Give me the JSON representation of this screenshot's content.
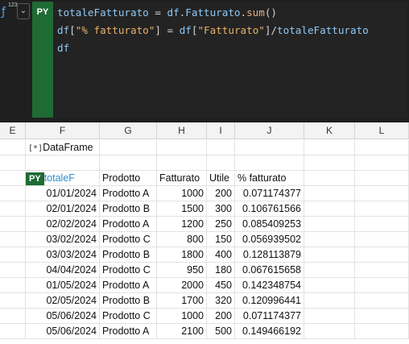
{
  "toolbar": {
    "fx_icon": "function-icon",
    "fx_sub": "123",
    "chevron": "⌄"
  },
  "editor": {
    "badge": "PY",
    "lines": [
      [
        {
          "t": "totaleFatturato",
          "c": "var"
        },
        {
          "t": " = ",
          "c": "op"
        },
        {
          "t": "df",
          "c": "var"
        },
        {
          "t": ".",
          "c": "op"
        },
        {
          "t": "Fatturato",
          "c": "var"
        },
        {
          "t": ".",
          "c": "op"
        },
        {
          "t": "sum",
          "c": "fn"
        },
        {
          "t": "()",
          "c": "op"
        }
      ],
      [
        {
          "t": "df",
          "c": "var"
        },
        {
          "t": "[",
          "c": "op"
        },
        {
          "t": "\"% fatturato\"",
          "c": "str"
        },
        {
          "t": "] = ",
          "c": "op"
        },
        {
          "t": "df",
          "c": "var"
        },
        {
          "t": "[",
          "c": "op"
        },
        {
          "t": "\"Fatturato\"",
          "c": "str"
        },
        {
          "t": "]/",
          "c": "op"
        },
        {
          "t": "totaleFatturato",
          "c": "var"
        }
      ],
      [
        {
          "t": "df",
          "c": "var"
        }
      ]
    ]
  },
  "columns": [
    "E",
    "F",
    "G",
    "H",
    "I",
    "J",
    "K",
    "L"
  ],
  "dataframe_label": "DataFrame",
  "dataframe_icon": "[*]",
  "table": {
    "py_badge": "PY",
    "index_header": "totaleF",
    "headers": [
      "Prodotto",
      "Fatturato",
      "Utile",
      "% fatturato"
    ],
    "rows": [
      [
        "01/01/2024",
        "Prodotto A",
        "1000",
        "200",
        "0.071174377"
      ],
      [
        "02/01/2024",
        "Prodotto B",
        "1500",
        "300",
        "0.106761566"
      ],
      [
        "02/02/2024",
        "Prodotto A",
        "1200",
        "250",
        "0.085409253"
      ],
      [
        "03/02/2024",
        "Prodotto C",
        "800",
        "150",
        "0.056939502"
      ],
      [
        "03/03/2024",
        "Prodotto B",
        "1800",
        "400",
        "0.128113879"
      ],
      [
        "04/04/2024",
        "Prodotto C",
        "950",
        "180",
        "0.067615658"
      ],
      [
        "01/05/2024",
        "Prodotto A",
        "2000",
        "450",
        "0.142348754"
      ],
      [
        "02/05/2024",
        "Prodotto B",
        "1700",
        "320",
        "0.120996441"
      ],
      [
        "05/06/2024",
        "Prodotto C",
        "1000",
        "200",
        "0.071174377"
      ],
      [
        "05/06/2024",
        "Prodotto A",
        "2100",
        "500",
        "0.149466192"
      ]
    ]
  }
}
